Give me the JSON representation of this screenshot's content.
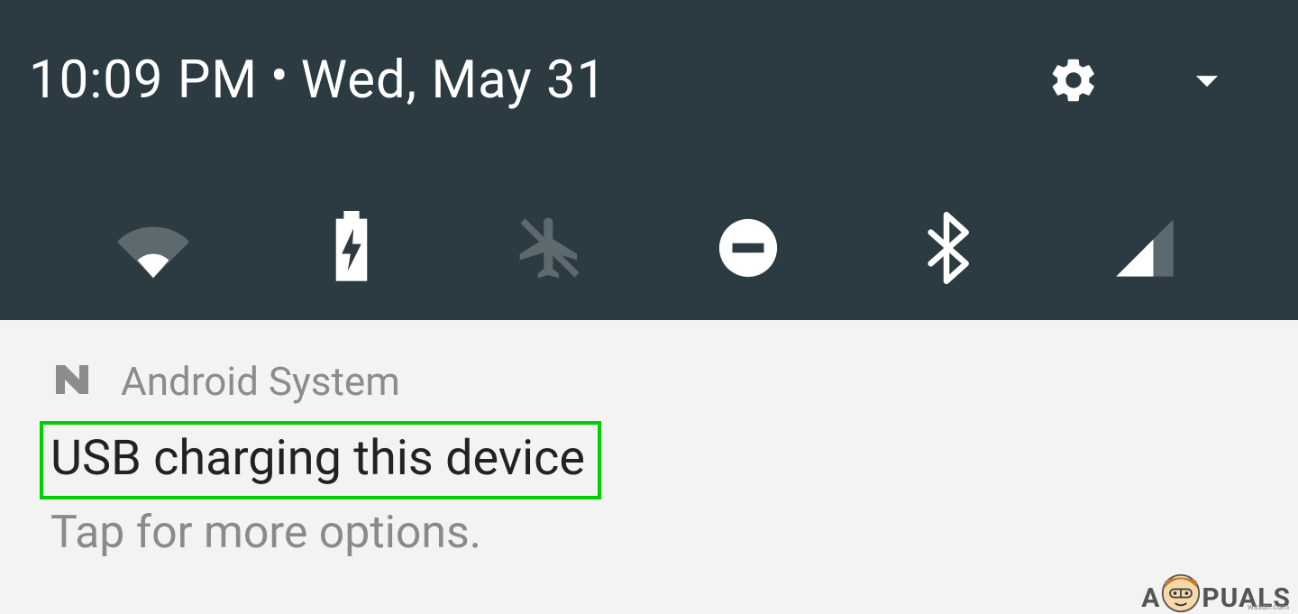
{
  "header": {
    "time": "10:09 PM",
    "separator": "•",
    "date": "Wed, May 31"
  },
  "quick_settings": {
    "tiles": [
      {
        "name": "wifi",
        "active": true
      },
      {
        "name": "battery-charging",
        "active": true
      },
      {
        "name": "airplane-mode",
        "active": false
      },
      {
        "name": "do-not-disturb",
        "active": true
      },
      {
        "name": "bluetooth",
        "active": true
      },
      {
        "name": "cellular-signal",
        "active": true
      }
    ]
  },
  "notification": {
    "app_name": "Android System",
    "title": "USB charging this device",
    "subtitle": "Tap for more options."
  },
  "watermark": {
    "prefix": "A",
    "suffix": "PUALS",
    "domain": "wsxdn.com"
  },
  "colors": {
    "panel_bg": "#2c3b41",
    "active_icon": "#ffffff",
    "inactive_icon": "#5c6a70",
    "notif_bg": "#f3f3f3",
    "notif_title": "#222222",
    "notif_muted": "#8c8c8c",
    "highlight_border": "#00d000"
  }
}
